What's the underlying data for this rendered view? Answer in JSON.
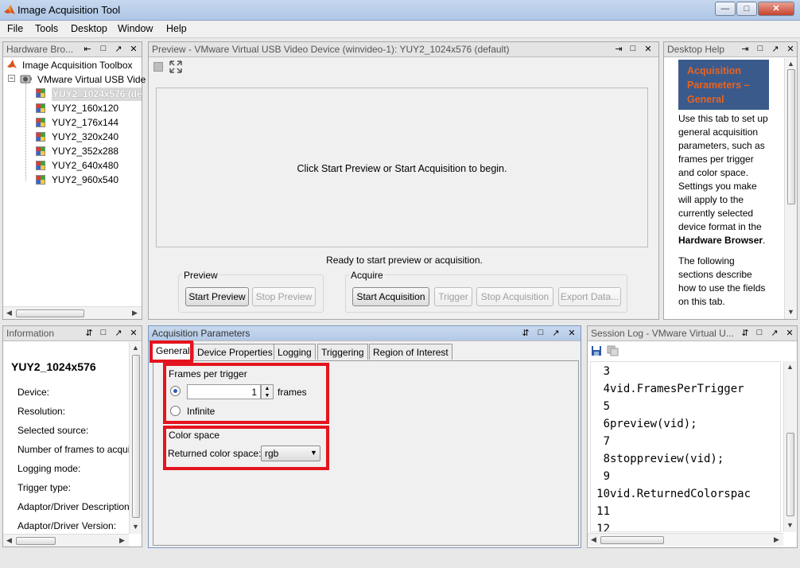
{
  "window": {
    "title": "Image Acquisition Tool",
    "controls": [
      "—",
      "□",
      "✕"
    ]
  },
  "menu": [
    "File",
    "Tools",
    "Desktop",
    "Window",
    "Help"
  ],
  "hardware": {
    "title": "Hardware Bro...",
    "root": "Image Acquisition Toolbox",
    "device": "VMware Virtual USB Vide",
    "formats": [
      "YUY2_1024x576 (de",
      "YUY2_160x120",
      "YUY2_176x144",
      "YUY2_320x240",
      "YUY2_352x288",
      "YUY2_640x480",
      "YUY2_960x540"
    ]
  },
  "preview": {
    "title": "Preview - VMware Virtual USB Video Device (winvideo-1): YUY2_1024x576 (default)",
    "message": "Click Start Preview or Start Acquisition to begin.",
    "status": "Ready to start preview or acquisition.",
    "preview_group": "Preview",
    "acquire_group": "Acquire",
    "start_preview": "Start Preview",
    "stop_preview": "Stop Preview",
    "start_acquisition": "Start Acquisition",
    "trigger": "Trigger",
    "stop_acquisition": "Stop Acquisition",
    "export_data": "Export Data..."
  },
  "help": {
    "title": "Desktop Help",
    "heading": [
      "Acquisition",
      "Parameters –",
      "General"
    ],
    "para1": [
      "Use this tab to set up",
      "general acquisition",
      "parameters, such as",
      "frames per trigger",
      "and color space.",
      "Settings you make",
      "will apply to the",
      "currently selected",
      "device format in the"
    ],
    "para1_bold": "Hardware Browser",
    "para1_end": ".",
    "para2": [
      "The following",
      "sections describe",
      "how to use the fields",
      "on this tab."
    ]
  },
  "info": {
    "title": "Information",
    "format": "YUY2_1024x576",
    "labels": [
      "Device:",
      "Resolution:",
      "Selected source:",
      "Number of frames to acqui",
      "Logging mode:",
      "Trigger type:",
      "Adaptor/Driver Description",
      "Adaptor/Driver Version:"
    ]
  },
  "params": {
    "title": "Acquisition Parameters",
    "tabs": [
      "General",
      "Device Properties",
      "Logging",
      "Triggering",
      "Region of Interest"
    ],
    "frames_group": "Frames per trigger",
    "frames_value": "1",
    "frames_unit": "frames",
    "infinite": "Infinite",
    "color_group": "Color space",
    "color_label": "Returned color space:",
    "color_value": "rgb"
  },
  "session": {
    "title": "Session Log - VMware Virtual U...",
    "lines": [
      {
        "n": "3",
        "code": ""
      },
      {
        "n": "4",
        "code": "vid.FramesPerTrigger"
      },
      {
        "n": "5",
        "code": ""
      },
      {
        "n": "6",
        "code": "preview(vid);"
      },
      {
        "n": "7",
        "code": ""
      },
      {
        "n": "8",
        "code": "stoppreview(vid);"
      },
      {
        "n": "9",
        "code": ""
      },
      {
        "n": "10",
        "code": "vid.ReturnedColorspac"
      },
      {
        "n": "11",
        "code": ""
      },
      {
        "n": "12",
        "code": ""
      }
    ]
  },
  "colors": {
    "highlight": "#e4141e",
    "help_heading_bg": "#3b5a8c",
    "help_heading_text": "#e8641e"
  }
}
